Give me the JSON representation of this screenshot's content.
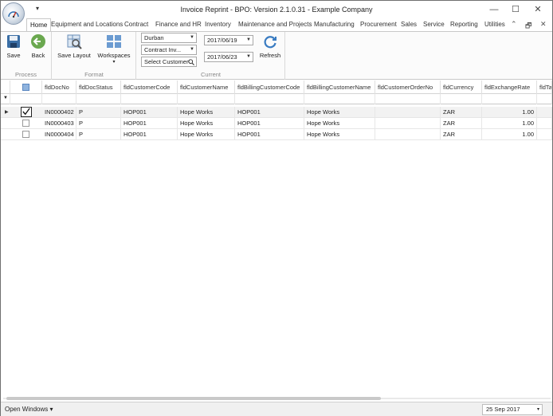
{
  "window": {
    "title": "Invoice Reprint - BPO: Version 2.1.0.31 - Example Company",
    "minimize": "—",
    "maximize": "☐",
    "close": "✕",
    "qat_arrow": "▾"
  },
  "tabs": [
    "Home",
    "Equipment and Locations",
    "Contract",
    "Finance and HR",
    "Inventory",
    "Maintenance and Projects",
    "Manufacturing",
    "Procurement",
    "Sales",
    "Service",
    "Reporting",
    "Utilities"
  ],
  "tabs_right": {
    "collapse": "⌃",
    "restore": "🗗",
    "close": "✕"
  },
  "ribbon": {
    "process": {
      "label": "Process",
      "save": "Save",
      "back": "Back"
    },
    "format": {
      "label": "Format",
      "save_layout": "Save Layout",
      "workspaces": "Workspaces",
      "workspaces_arrow": "▾"
    },
    "current": {
      "label": "Current",
      "site": "Durban",
      "contract": "Contract Inv...",
      "customer": "Select Customer",
      "date_from": "2017/06/19",
      "date_to": "2017/06/23",
      "refresh": "Refresh"
    }
  },
  "grid": {
    "columns": [
      "fldDocNo",
      "fldDocStatus",
      "fldCustomerCode",
      "fldCustomerName",
      "fldBillingCustomerCode",
      "fldBillingCustomerName",
      "fldCustomerOrderNo",
      "fldCurrency",
      "fldExchangeRate",
      "fldTa"
    ],
    "filter_icon": "▼",
    "rows": [
      {
        "selected": true,
        "checked": true,
        "DocNo": "IN0000402",
        "DocStatus": "P",
        "CustomerCode": "HOP001",
        "CustomerName": "Hope Works",
        "BillingCustomerCode": "HOP001",
        "BillingCustomerName": "Hope Works",
        "CustomerOrderNo": "",
        "Currency": "ZAR",
        "ExchangeRate": "1.00"
      },
      {
        "selected": false,
        "checked": false,
        "DocNo": "IN0000403",
        "DocStatus": "P",
        "CustomerCode": "HOP001",
        "CustomerName": "Hope Works",
        "BillingCustomerCode": "HOP001",
        "BillingCustomerName": "Hope Works",
        "CustomerOrderNo": "",
        "Currency": "ZAR",
        "ExchangeRate": "1.00"
      },
      {
        "selected": false,
        "checked": false,
        "DocNo": "IN0000404",
        "DocStatus": "P",
        "CustomerCode": "HOP001",
        "CustomerName": "Hope Works",
        "BillingCustomerCode": "HOP001",
        "BillingCustomerName": "Hope Works",
        "CustomerOrderNo": "",
        "Currency": "ZAR",
        "ExchangeRate": "1.00"
      }
    ]
  },
  "status": {
    "open_windows": "Open Windows ▾",
    "date": "25 Sep 2017",
    "date_arrow": "▾"
  },
  "colors": {
    "accent": "#2f6fb0",
    "border": "#c9c9c9",
    "selected_row": "#f2f2f2"
  }
}
